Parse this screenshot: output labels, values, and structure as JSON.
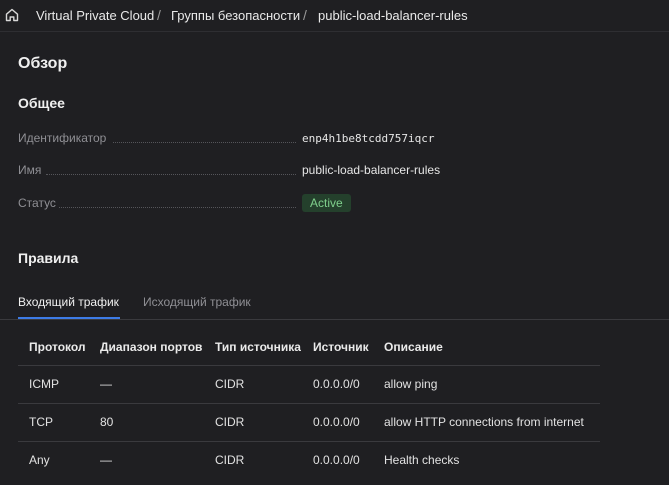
{
  "breadcrumb": {
    "home_icon": "home-icon",
    "items": [
      "Virtual Private Cloud",
      "Группы безопасности",
      "public-load-balancer-rules"
    ],
    "separator": "/"
  },
  "overview": {
    "title": "Обзор",
    "general_title": "Общее",
    "fields": [
      {
        "label": "Идентификатор",
        "value": "enp4h1be8tcdd757iqcr"
      },
      {
        "label": "Имя",
        "value": "public-load-balancer-rules"
      },
      {
        "label": "Статус",
        "value": "Active"
      }
    ]
  },
  "rules": {
    "title": "Правила",
    "tabs": [
      {
        "label": "Входящий трафик",
        "active": true
      },
      {
        "label": "Исходящий трафик",
        "active": false
      }
    ],
    "columns": [
      "Протокол",
      "Диапазон портов",
      "Тип источника",
      "Источник",
      "Описание"
    ],
    "rows": [
      [
        "ICMP",
        "—",
        "CIDR",
        "0.0.0.0/0",
        "allow ping"
      ],
      [
        "TCP",
        "80",
        "CIDR",
        "0.0.0.0/0",
        "allow HTTP connections from internet"
      ],
      [
        "Any",
        "—",
        "CIDR",
        "0.0.0.0/0",
        "Health checks"
      ]
    ]
  },
  "colors": {
    "background": "#1f1f22",
    "accent": "#3d7be6",
    "status_active_bg": "#24402c",
    "status_active_text": "#7fd08c"
  }
}
